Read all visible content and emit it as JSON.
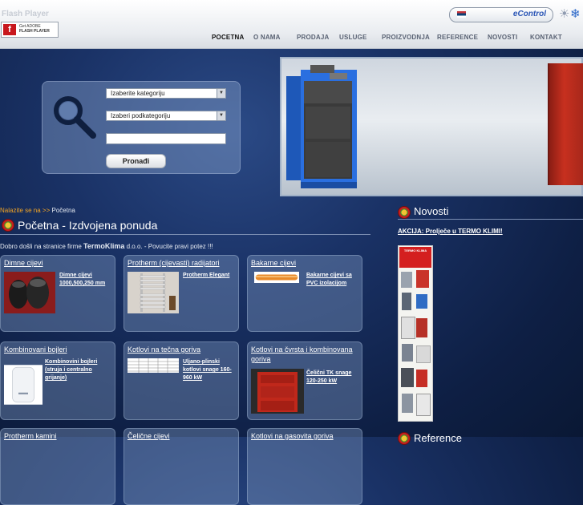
{
  "flash": {
    "label": "Flash Player",
    "badge_line1": "Get ADOBE",
    "badge_line2": "FLASH PLAYER"
  },
  "top": {
    "econtrol": "eControl"
  },
  "nav": {
    "items": [
      "POCETNA",
      "O NAMA",
      "PRODAJA",
      "USLUGE",
      "PROIZVODNJA",
      "REFERENCE",
      "NOVOSTI",
      "KONTAKT"
    ],
    "active": "POCETNA"
  },
  "search": {
    "category_select": "Izaberite kategoriju",
    "subcategory_select": "Izaberi podkategoriju",
    "query_value": "",
    "button": "Pronađi"
  },
  "breadcrumb": {
    "label": "Nalazite se na >>",
    "current": "Početna"
  },
  "main": {
    "title": "Početna - Izdvojena ponuda",
    "welcome_before": "Dobro došli na stranice firme ",
    "welcome_brand": "TermoKlima",
    "welcome_after": " d.o.o. - Povucite pravi potez !!!"
  },
  "cards": [
    {
      "title": "Dimne cijevi",
      "link": "Dimne cijevi 1000,500,250 mm",
      "thumb": "black-pipes"
    },
    {
      "title": "Protherm (cijevasti) radijatori",
      "link": "Protherm Elegant",
      "thumb": "towel-radiator"
    },
    {
      "title": "Bakarne cijevi",
      "link": "Bakarne cijevi sa PVC izolacijom",
      "thumb": "copper-pipe"
    },
    {
      "title": "Kombinovani bojleri",
      "link": "Kombinovini bojleri (struja i centralno grijanje)",
      "thumb": "water-heater"
    },
    {
      "title": "Kotlovi na tečna goriva",
      "link": "Uljano-plinski kotlovi snage 160-960 kW",
      "thumb": "spec-table"
    },
    {
      "title": "Kotlovi na čvrsta i kombinovana goriva",
      "link": "Čelični TK snage 120-250 kW",
      "thumb": "red-boiler"
    },
    {
      "title": "Protherm kamini",
      "link": "",
      "thumb": ""
    },
    {
      "title": "Čelične cijevi",
      "link": "",
      "thumb": ""
    },
    {
      "title": "Kotlovi na gasovita goriva",
      "link": "",
      "thumb": ""
    }
  ],
  "news": {
    "title": "Novosti",
    "link": "AKCIJA: Prolječe u TERMO KLIMI!",
    "flyer_header": "TERMO KLIMA"
  },
  "references": {
    "title": "Reference"
  },
  "colors": {
    "background": "#102246",
    "accent_orange": "#f5a623",
    "econtrol_blue": "#2a55b5"
  }
}
